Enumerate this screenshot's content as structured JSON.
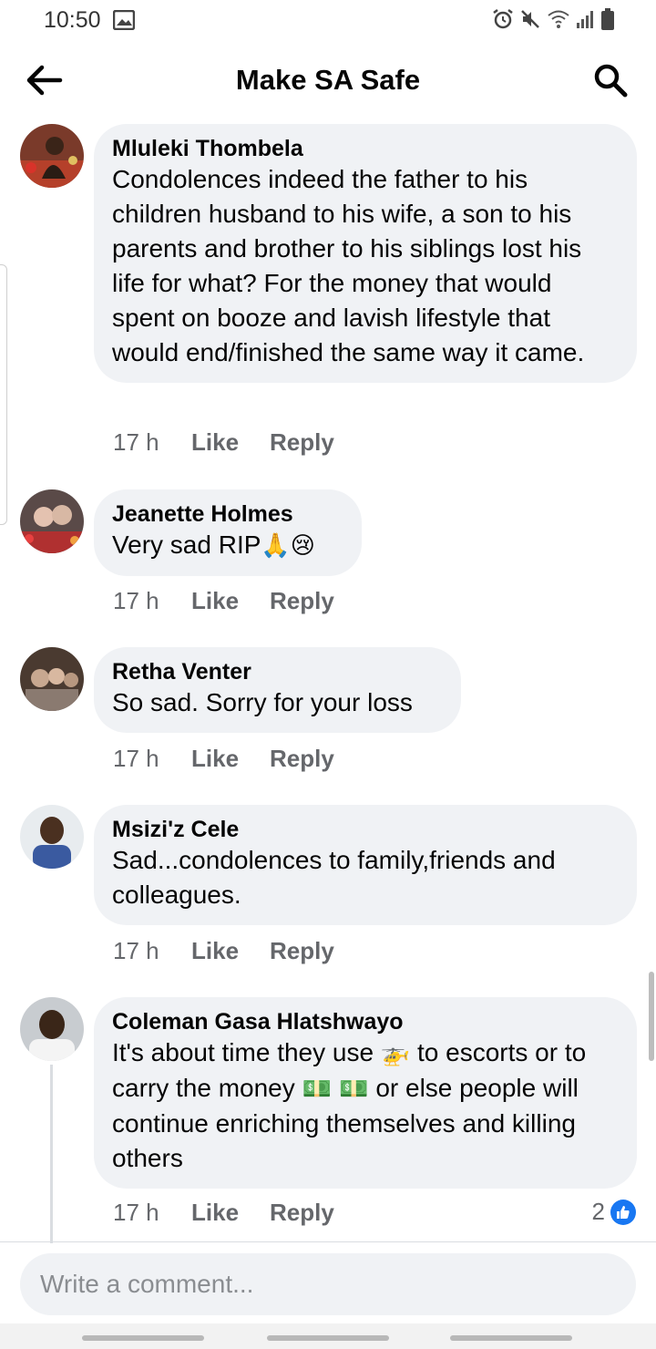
{
  "status_bar": {
    "time": "10:50",
    "icons": [
      "gallery-icon",
      "alarm-icon",
      "mute-icon",
      "wifi-icon",
      "signal-icon",
      "battery-icon"
    ]
  },
  "header": {
    "title": "Make SA Safe",
    "back_icon": "arrow-left-icon",
    "search_icon": "search-icon"
  },
  "comments": [
    {
      "author": "Mluleki Thombela",
      "text": "Condolences indeed the father to his children husband to his wife, a son to his parents and brother to his siblings lost his life  for what? For the money that would spent on booze and lavish lifestyle that would  end/finished the same way it came.",
      "time": "17 h",
      "like": "Like",
      "reply": "Reply"
    },
    {
      "author": "Jeanette Holmes",
      "text": "Very sad RIP",
      "emojis": "🙏😢",
      "time": "17 h",
      "like": "Like",
      "reply": "Reply"
    },
    {
      "author": "Retha Venter",
      "text": "So sad. Sorry for your loss",
      "time": "17 h",
      "like": "Like",
      "reply": "Reply"
    },
    {
      "author": "Msizi'z Cele",
      "text": "Sad...condolences  to family,friends  and colleagues.",
      "time": "17 h",
      "like": "Like",
      "reply": "Reply"
    },
    {
      "author": "Coleman Gasa Hlatshwayo",
      "text_part1": "It's about time they use ",
      "emoji_helicopter": "🚁",
      "text_part2": " to escorts or to carry the money ",
      "emoji_money": "💵 💵",
      "text_part3": " or else people will continue enriching themselves and killing others",
      "time": "17 h",
      "like": "Like",
      "reply": "Reply",
      "reaction_count": "2"
    }
  ],
  "composer": {
    "placeholder": "Write a comment..."
  },
  "colors": {
    "bubble": "#f0f2f5",
    "secondary_text": "#65676b",
    "like_blue": "#1877f2"
  }
}
